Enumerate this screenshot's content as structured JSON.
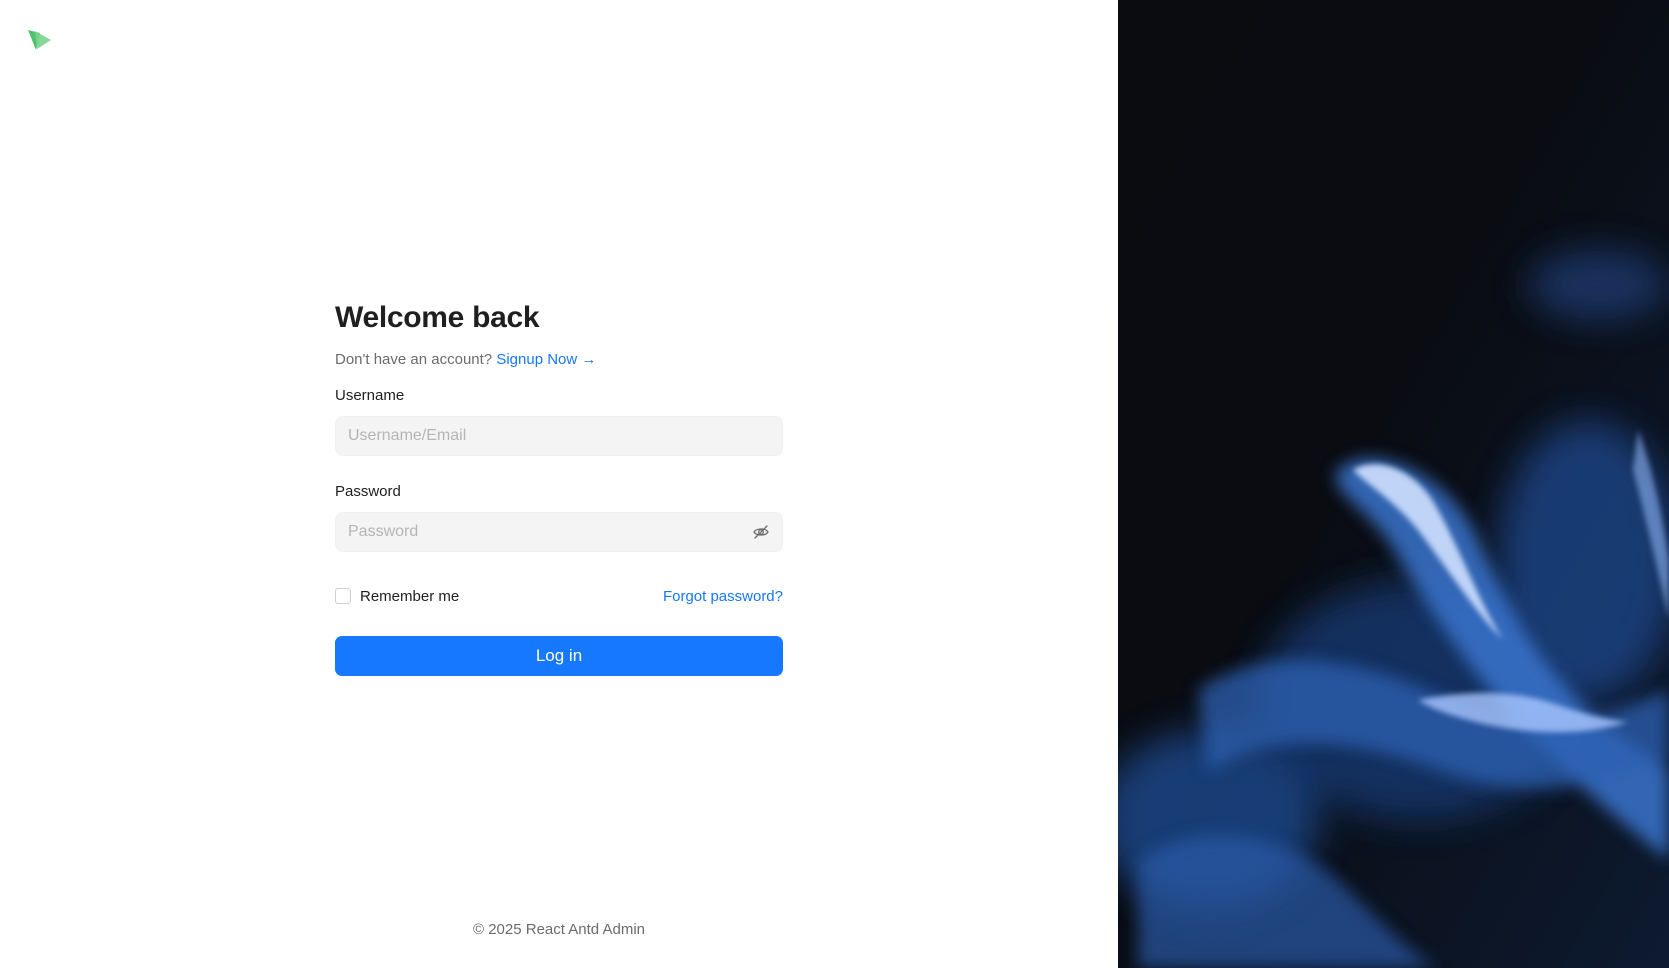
{
  "brand": {
    "logo_icon": "brand-logo-icon",
    "accent": "#1677ff",
    "logo_color": "#4fc36b"
  },
  "login": {
    "title": "Welcome back",
    "no_account_text": "Don't have an account?",
    "signup_link": "Signup Now →",
    "username_label": "Username",
    "username_placeholder": "Username/Email",
    "password_label": "Password",
    "password_placeholder": "Password",
    "remember_label": "Remember me",
    "forgot_link": "Forgot password?",
    "submit_label": "Log in"
  },
  "footer": {
    "copyright": "© 2025 React Antd Admin"
  },
  "hero": {
    "image": "blue-smoke-background"
  }
}
